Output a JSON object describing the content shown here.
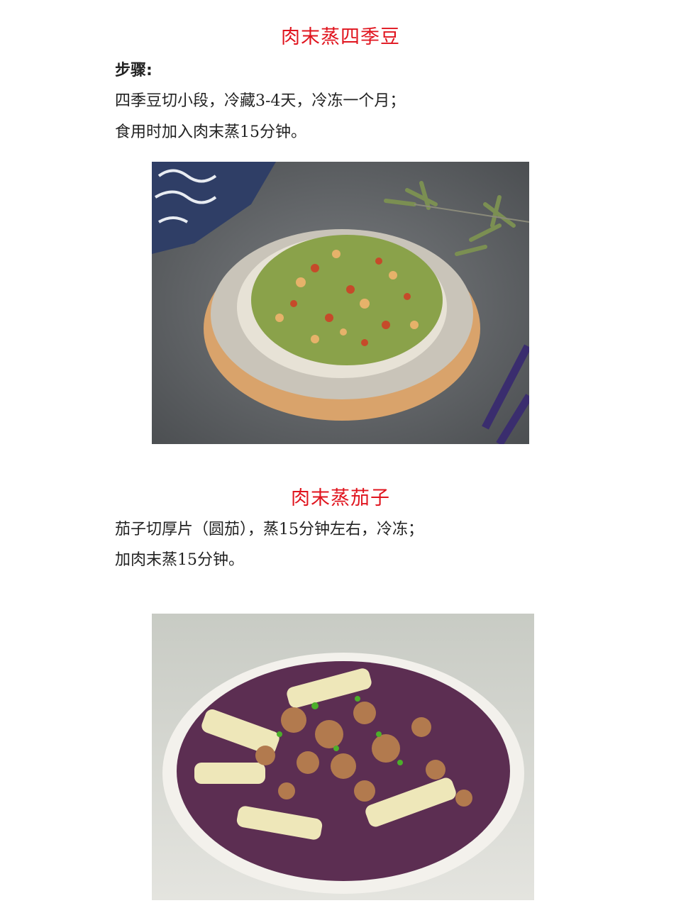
{
  "section1": {
    "title": "肉末蒸四季豆",
    "steps_label": "步骤:",
    "lines": [
      "四季豆切小段，冷藏3-4天，冷冻一个月；",
      "食用时加入肉末蒸15分钟。"
    ],
    "photo": "dish-green-beans-minced-pork-photo"
  },
  "section2": {
    "title": "肉末蒸茄子",
    "lines": [
      "茄子切厚片（圆茄），蒸15分钟左右，冷冻；",
      "加肉末蒸15分钟。"
    ],
    "photo": "dish-eggplant-minced-pork-photo"
  },
  "colors": {
    "title_red": "#e0141e",
    "text": "#222222"
  }
}
